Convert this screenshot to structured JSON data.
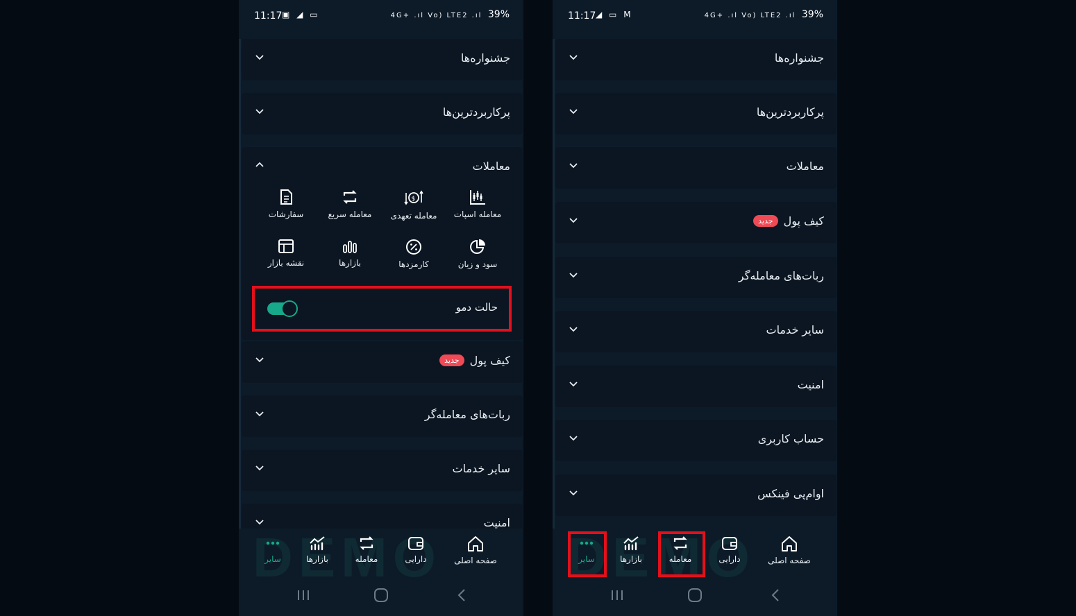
{
  "status": {
    "time": "11:17",
    "battery": "39%",
    "signal_icons_left": "▣ ◢ ▭",
    "signal_icons_left_right_phone": "◢ ▭ M",
    "net": "4G+ .ıl Vo) LTE2 .ıl"
  },
  "left_phone": {
    "sections_top": [
      "جشنواره‌ها",
      "پرکاربردترین‌ها"
    ],
    "trades": {
      "title": "معاملات",
      "grid": [
        {
          "label": "سفارشات",
          "icon": "document-icon"
        },
        {
          "label": "معامله سریع",
          "icon": "swap-icon"
        },
        {
          "label": "معامله تعهدی",
          "icon": "margin-icon"
        },
        {
          "label": "معامله اسپات",
          "icon": "candles-icon"
        },
        {
          "label": "نقشه بازار",
          "icon": "map-icon"
        },
        {
          "label": "بازارها",
          "icon": "bars-icon"
        },
        {
          "label": "کارمزدها",
          "icon": "percent-icon"
        },
        {
          "label": "سود و زیان",
          "icon": "pie-icon"
        }
      ],
      "demo_label": "حالت دمو",
      "demo_on": true
    },
    "sections_bottom": [
      {
        "label": "کیف پول",
        "badge": "جدید"
      },
      {
        "label": "ربات‌های معامله‌گر"
      },
      {
        "label": "سایر خدمات"
      },
      {
        "label": "امنیت"
      }
    ]
  },
  "right_phone": {
    "sections": [
      {
        "label": "جشنواره‌ها"
      },
      {
        "label": "پرکاربردترین‌ها"
      },
      {
        "label": "معاملات"
      },
      {
        "label": "کیف پول",
        "badge": "جدید"
      },
      {
        "label": "ربات‌های معامله‌گر"
      },
      {
        "label": "سایر خدمات"
      },
      {
        "label": "امنیت"
      },
      {
        "label": "حساب کاربری"
      },
      {
        "label": "اوام‌پی فینکس"
      }
    ]
  },
  "nav": {
    "others": "سایر",
    "markets": "بازارها",
    "trade": "معامله",
    "assets": "دارایی",
    "home": "صفحه اصلی",
    "watermark": "DEMO"
  },
  "colors": {
    "accent": "#16a98a",
    "badge": "#ef4a55",
    "highlight": "#e3101b",
    "background": "#0d1b29"
  }
}
